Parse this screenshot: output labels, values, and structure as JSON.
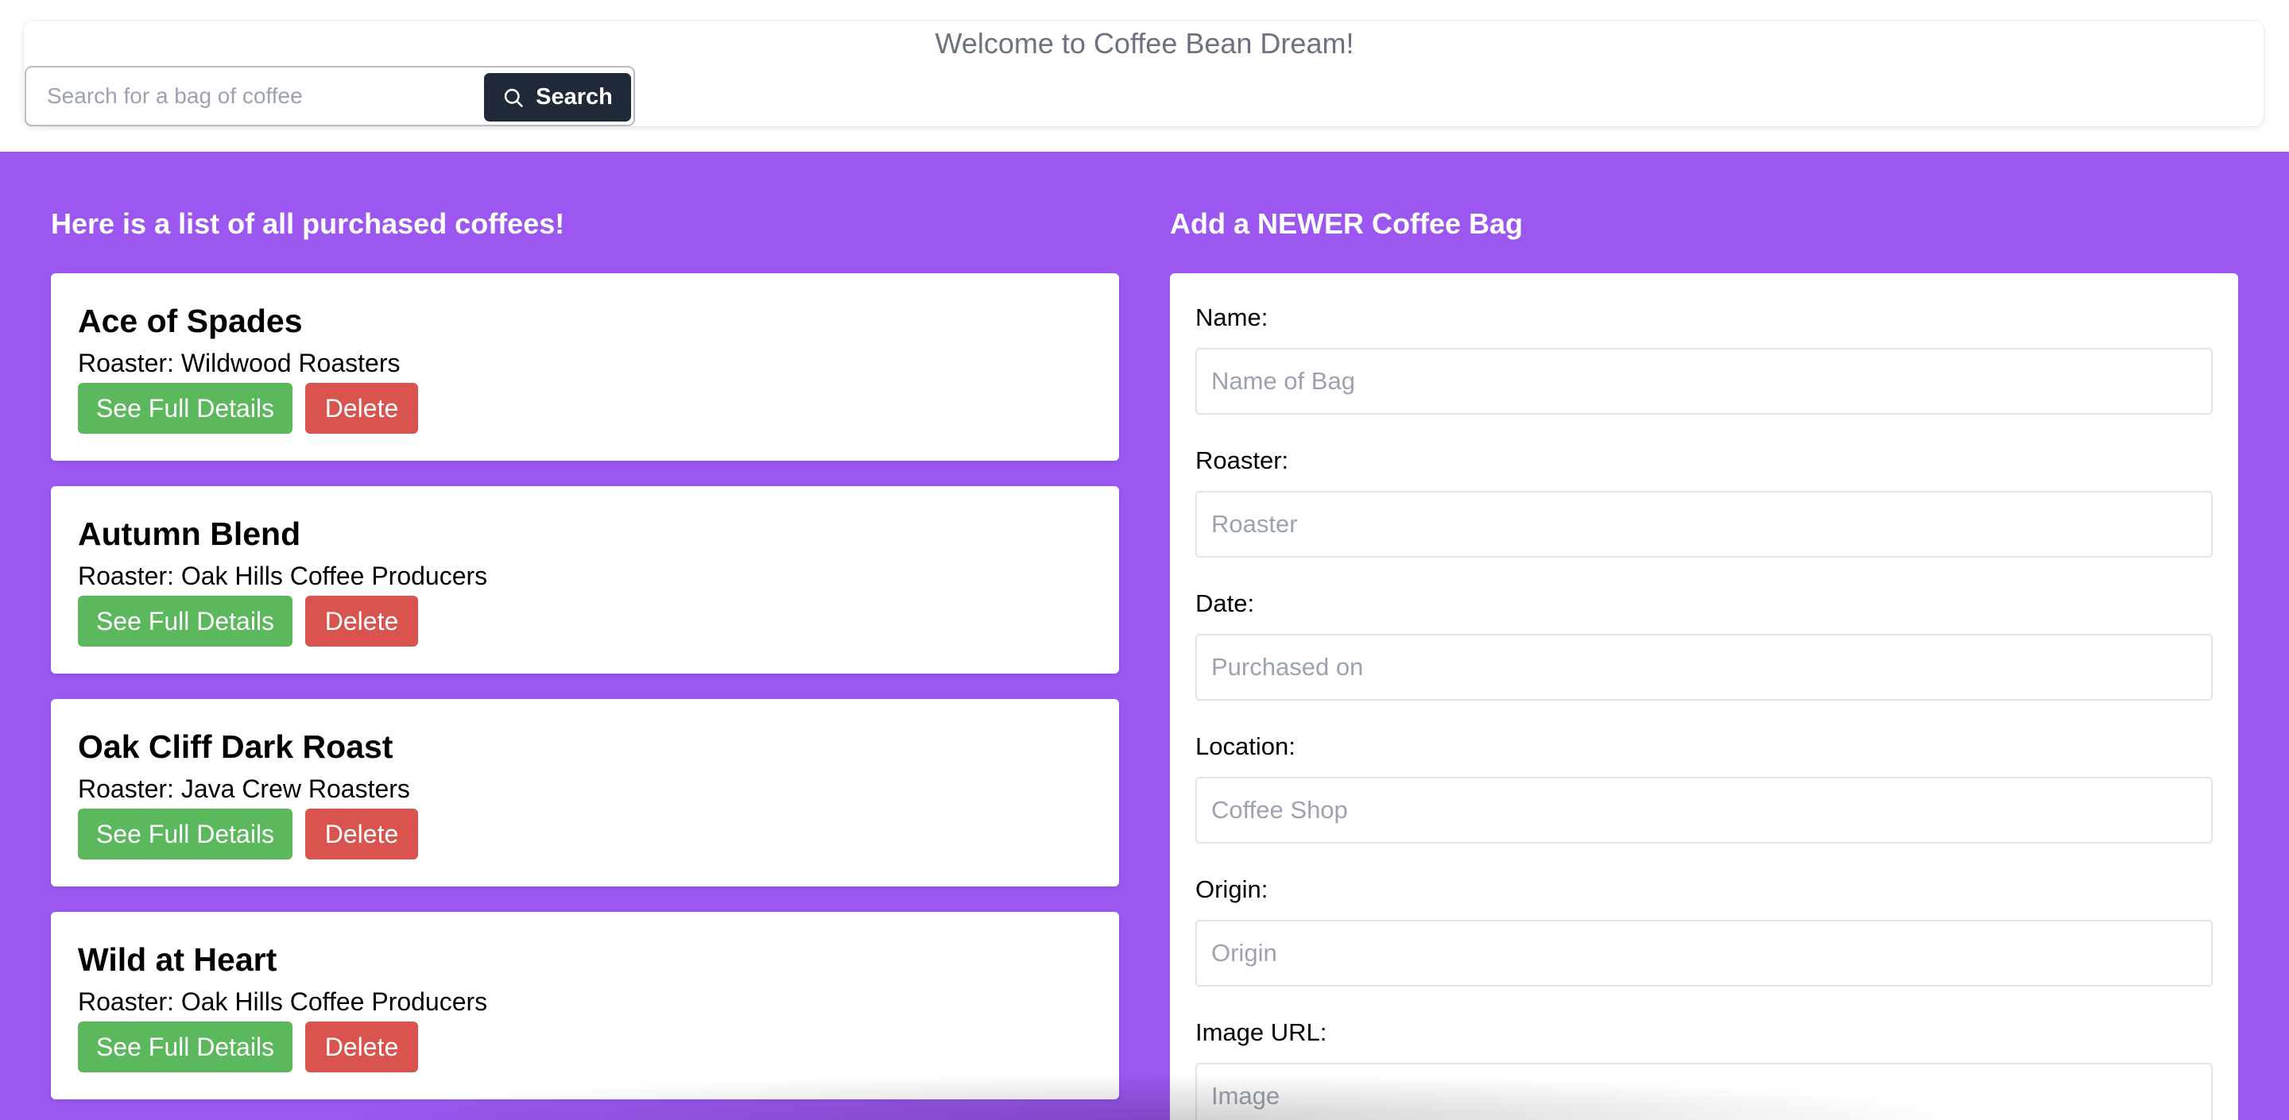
{
  "header": {
    "welcome": "Welcome to Coffee Bean Dream!",
    "search": {
      "placeholder": "Search for a bag of coffee",
      "button_label": "Search",
      "button_icon": "search-icon"
    }
  },
  "list": {
    "title": "Here is a list of all purchased coffees!",
    "roaster_prefix": "Roaster: ",
    "details_label": "See Full Details",
    "delete_label": "Delete",
    "items": [
      {
        "name": "Ace of Spades",
        "roaster": "Wildwood Roasters"
      },
      {
        "name": "Autumn Blend",
        "roaster": "Oak Hills Coffee Producers"
      },
      {
        "name": "Oak Cliff Dark Roast",
        "roaster": "Java Crew Roasters"
      },
      {
        "name": "Wild at Heart",
        "roaster": "Oak Hills Coffee Producers"
      }
    ]
  },
  "form": {
    "title": "Add a NEWER Coffee Bag",
    "fields": [
      {
        "label": "Name:",
        "placeholder": "Name of Bag"
      },
      {
        "label": "Roaster:",
        "placeholder": "Roaster"
      },
      {
        "label": "Date:",
        "placeholder": "Purchased on"
      },
      {
        "label": "Location:",
        "placeholder": "Coffee Shop"
      },
      {
        "label": "Origin:",
        "placeholder": "Origin"
      },
      {
        "label": "Image URL:",
        "placeholder": "Image"
      }
    ]
  },
  "colors": {
    "background": "#9b57ef",
    "search_button": "#1f2937",
    "details_button": "#5cb85c",
    "delete_button": "#d9534f"
  }
}
